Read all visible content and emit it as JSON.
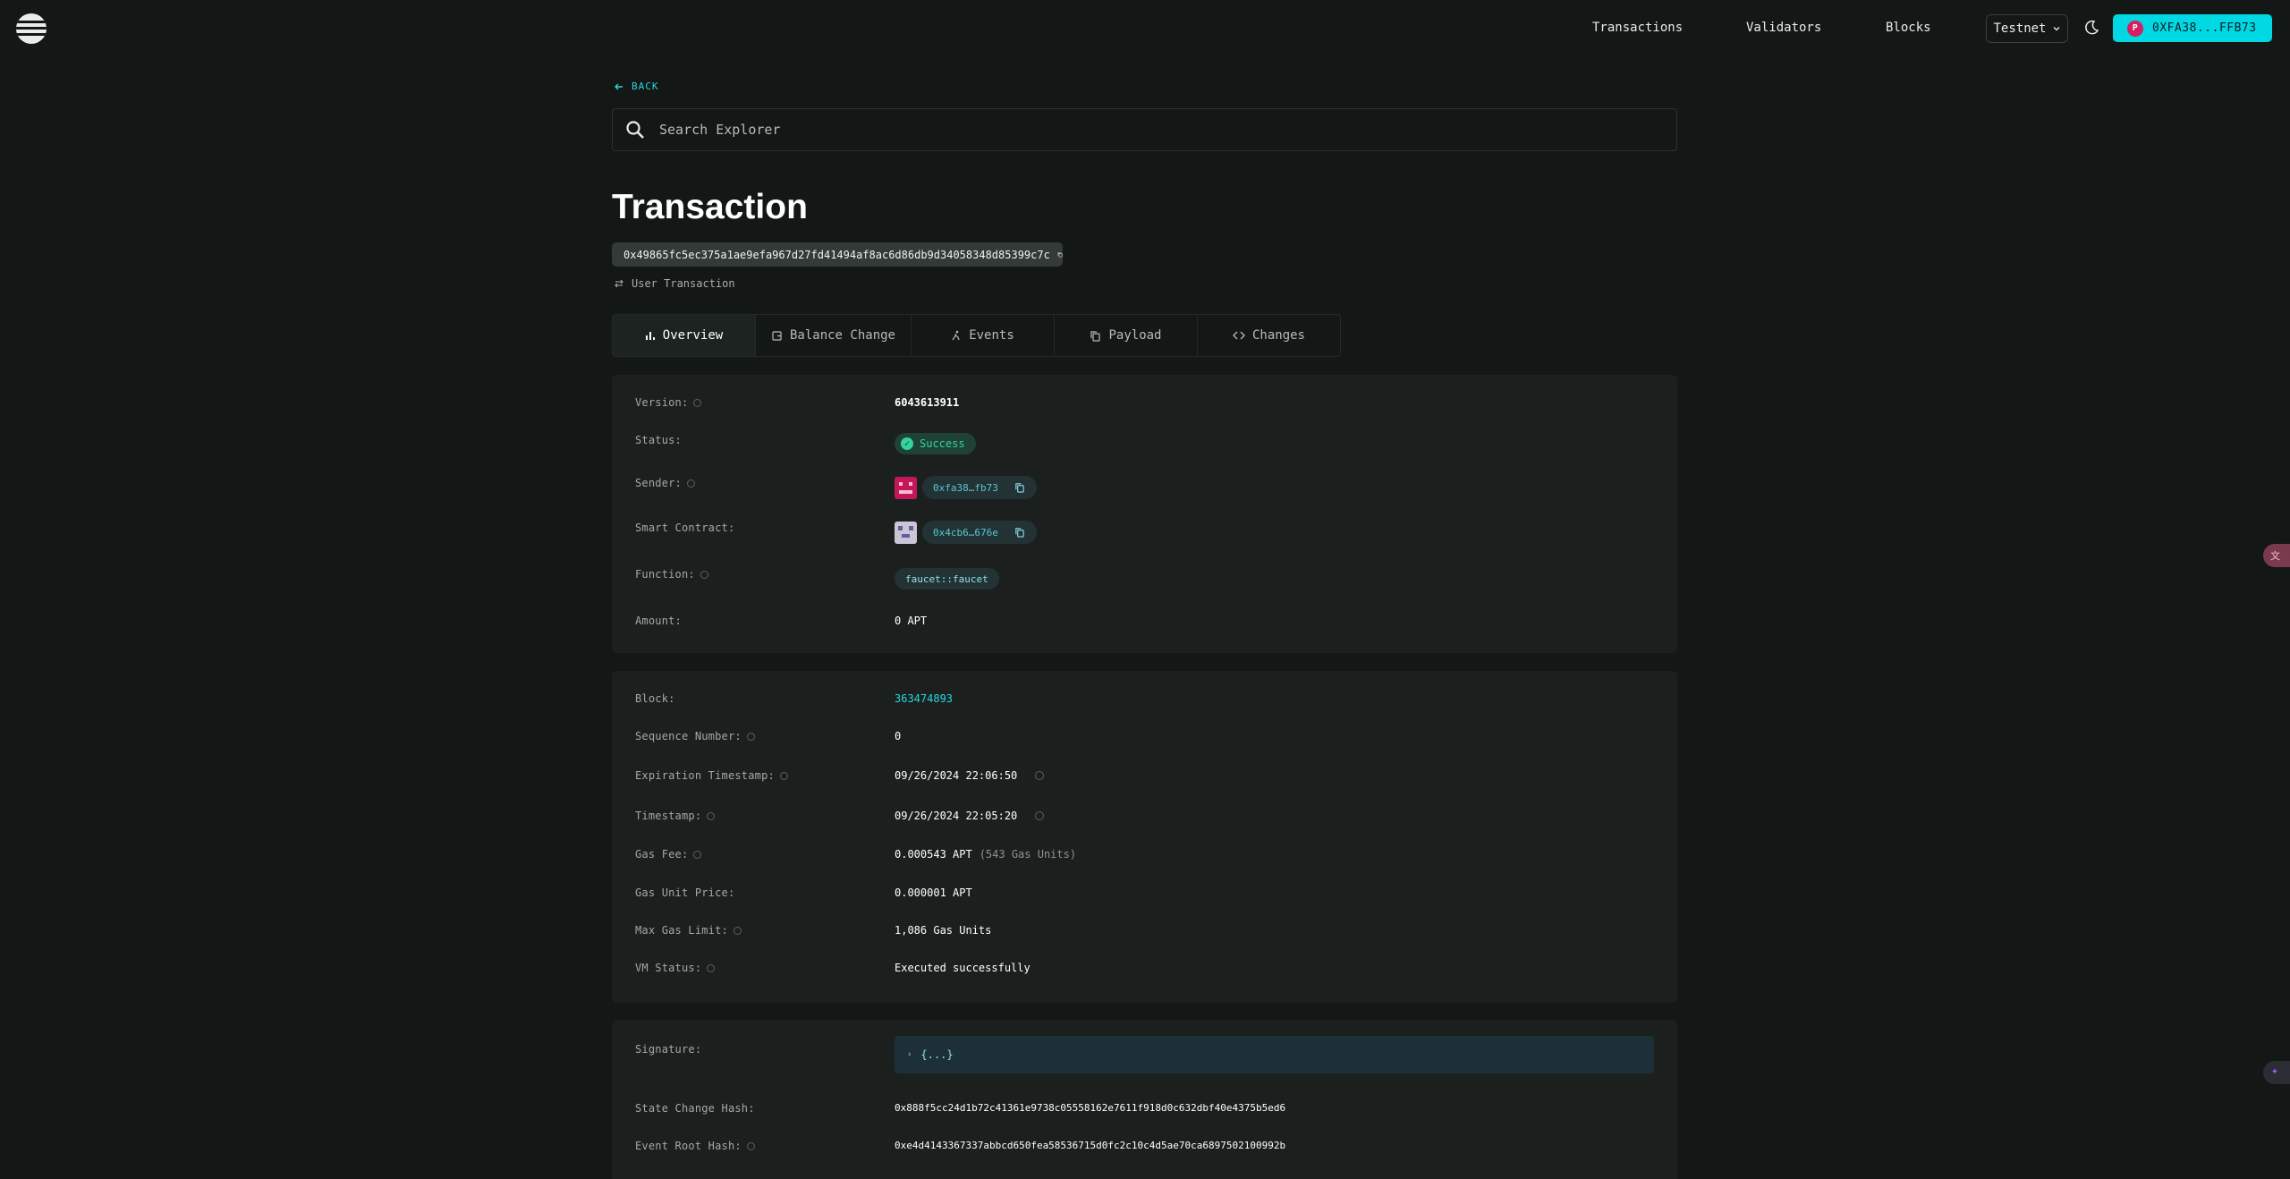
{
  "header": {
    "nav": [
      "Transactions",
      "Validators",
      "Blocks"
    ],
    "network": "Testnet",
    "wallet": "0XFA38...FFB73",
    "wallet_avatar": "P"
  },
  "back_label": "BACK",
  "search": {
    "placeholder": "Search Explorer"
  },
  "page_title": "Transaction",
  "tx_hash": "0x49865fc5ec375a1ae9efa967d27fd41494af8ac6d86db9d34058348d85399c7c",
  "tx_type": "User Transaction",
  "tabs": [
    "Overview",
    "Balance Change",
    "Events",
    "Payload",
    "Changes"
  ],
  "overview": {
    "version_label": "Version:",
    "version": "6043613911",
    "status_label": "Status:",
    "status": "Success",
    "sender_label": "Sender:",
    "sender": "0xfa38…fb73",
    "contract_label": "Smart Contract:",
    "contract": "0x4cb6…676e",
    "function_label": "Function:",
    "function": "faucet::faucet",
    "amount_label": "Amount:",
    "amount": "0 APT"
  },
  "details": {
    "block_label": "Block:",
    "block": "363474893",
    "seq_label": "Sequence Number:",
    "seq": "0",
    "exp_label": "Expiration Timestamp:",
    "exp": "09/26/2024 22:06:50",
    "ts_label": "Timestamp:",
    "ts": "09/26/2024 22:05:20",
    "gasfee_label": "Gas Fee:",
    "gasfee": "0.000543 APT",
    "gasfee_units": "(543 Gas Units)",
    "gasprice_label": "Gas Unit Price:",
    "gasprice": "0.000001 APT",
    "maxgas_label": "Max Gas Limit:",
    "maxgas": "1,086 Gas Units",
    "vm_label": "VM Status:",
    "vm": "Executed successfully"
  },
  "more": {
    "sig_label": "Signature:",
    "sig": "{...}",
    "sch_label": "State Change Hash:",
    "sch": "0x888f5cc24d1b72c41361e9738c05558162e7611f918d0c632dbf40e4375b5ed6",
    "erh_label": "Event Root Hash:",
    "erh": "0xe4d4143367337abbcd650fea58536715d0fc2c10c4d5ae70ca6897502100992b"
  },
  "colors": {
    "accent": "#29d5de",
    "wallet_bg": "#00d8e4",
    "success": "#35d29b"
  }
}
